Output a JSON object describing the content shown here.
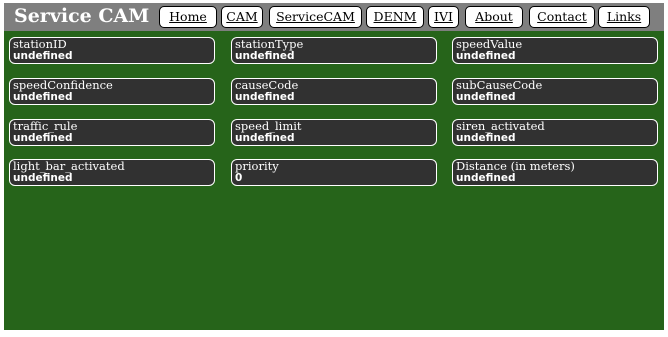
{
  "header": {
    "title": "Service CAM",
    "nav": [
      "Home",
      "CAM",
      "ServiceCAM",
      "DENM",
      "IVI",
      "About",
      "Contact",
      "Links"
    ]
  },
  "fields": [
    {
      "label": "stationID",
      "value": "undefined"
    },
    {
      "label": "stationType",
      "value": "undefined"
    },
    {
      "label": "speedValue",
      "value": "undefined"
    },
    {
      "label": "speedConfidence",
      "value": "undefined"
    },
    {
      "label": "causeCode",
      "value": "undefined"
    },
    {
      "label": "subCauseCode",
      "value": "undefined"
    },
    {
      "label": "traffic_rule",
      "value": "undefined"
    },
    {
      "label": "speed_limit",
      "value": "undefined"
    },
    {
      "label": "siren_activated",
      "value": "undefined"
    },
    {
      "label": "light_bar_activated",
      "value": "undefined"
    },
    {
      "label": "priority",
      "value": "0"
    },
    {
      "label": "Distance (in meters)",
      "value": "undefined"
    }
  ],
  "colors": {
    "background": "#26641a",
    "header": "#7f7f7f",
    "card": "#313131"
  }
}
